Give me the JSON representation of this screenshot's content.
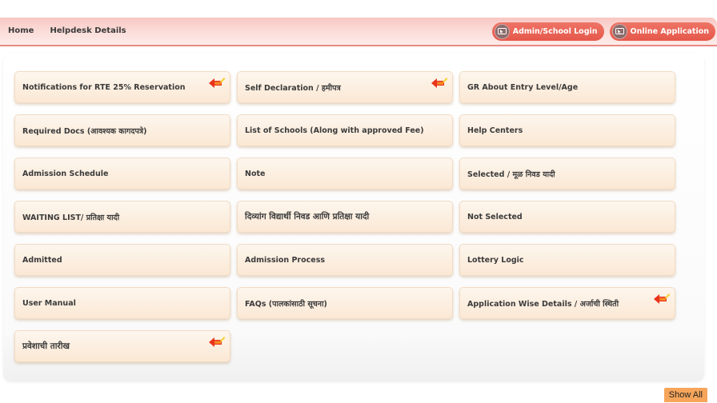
{
  "nav": {
    "links": [
      "Home",
      "Helpdesk Details"
    ],
    "buttons": [
      {
        "label": "Admin/School Login",
        "icon": "monitor-cursor-icon"
      },
      {
        "label": "Online Application",
        "icon": "monitor-cursor-icon"
      }
    ]
  },
  "tiles": [
    {
      "label": "Notifications for RTE 25% Reservation",
      "new": true
    },
    {
      "label": "Self Declaration / हमीपत्र",
      "new": true
    },
    {
      "label": "GR About Entry Level/Age",
      "new": false
    },
    {
      "label": "Required Docs (आवश्यक कागदपत्रे)",
      "new": false
    },
    {
      "label": "List of Schools (Along with approved Fee)",
      "new": false
    },
    {
      "label": "Help Centers",
      "new": false
    },
    {
      "label": "Admission Schedule",
      "new": false
    },
    {
      "label": "Note",
      "new": false
    },
    {
      "label": "Selected / मूळ निवड यादी",
      "new": false
    },
    {
      "label": "WAITING LIST/ प्रतिक्षा यादी",
      "new": false
    },
    {
      "label": "दिव्यांग विद्यार्थी निवड आणि प्रतिक्षा यादी",
      "new": false
    },
    {
      "label": "Not Selected",
      "new": false
    },
    {
      "label": "Admitted",
      "new": false
    },
    {
      "label": "Admission Process",
      "new": false
    },
    {
      "label": "Lottery Logic",
      "new": false
    },
    {
      "label": "User Manual",
      "new": false
    },
    {
      "label": "FAQs (पालकांसाठी सूचना)",
      "new": false
    },
    {
      "label": "Application Wise Details / अर्जाची स्थिती",
      "new": true
    },
    {
      "label": "प्रवेशाची तारीख",
      "new": true
    }
  ],
  "show_all_label": "Show All",
  "colors": {
    "nav_bg": "#f8c7c3",
    "pill_btn": "#e85d4f",
    "tile_bg": "#fbe8d4",
    "show_all_bg": "#f6a55a"
  }
}
